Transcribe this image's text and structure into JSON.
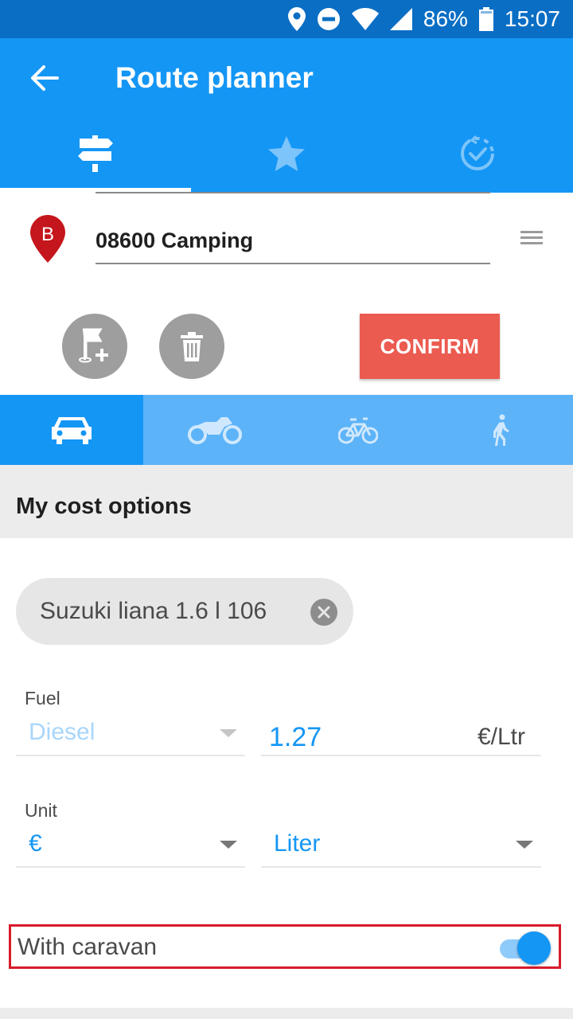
{
  "status_bar": {
    "battery": "86%",
    "time": "15:07",
    "icons": [
      "location-icon",
      "do-not-disturb-icon",
      "wifi-icon",
      "signal-icon",
      "battery-icon"
    ]
  },
  "app_bar": {
    "title": "Route planner",
    "back_icon": "arrow-back-icon"
  },
  "tabs": [
    {
      "icon": "signpost-icon",
      "active": true
    },
    {
      "icon": "star-icon",
      "active": false
    },
    {
      "icon": "history-icon",
      "active": false
    }
  ],
  "destination": {
    "marker_letter": "B",
    "value": "08600 Camping"
  },
  "actions": {
    "confirm_label": "CONFIRM"
  },
  "transport_modes": [
    {
      "icon": "car-icon",
      "active": true
    },
    {
      "icon": "motorcycle-icon",
      "active": false
    },
    {
      "icon": "bicycle-icon",
      "active": false
    },
    {
      "icon": "walk-icon",
      "active": false
    }
  ],
  "cost_options": {
    "title": "My cost options",
    "vehicle": "Suzuki liana 1.6 l 106",
    "fuel_label": "Fuel",
    "fuel_type": "Diesel",
    "fuel_price": "1.27",
    "price_unit": "€/Ltr",
    "unit_label": "Unit",
    "currency": "€",
    "volume_unit": "Liter",
    "caravan_label": "With caravan",
    "caravan_enabled": true
  },
  "colors": {
    "primary": "#1496f5",
    "status_bar": "#0a6ec4",
    "confirm": "#ec5b50",
    "highlight_border": "#d81b2a"
  }
}
